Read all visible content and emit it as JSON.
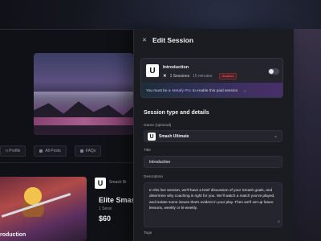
{
  "background": {
    "tabs": [
      {
        "label": "n Profile",
        "icon": "user-icon"
      },
      {
        "label": "All Posts",
        "icon": "grid-icon"
      },
      {
        "label": "FAQs",
        "icon": "help-icon"
      }
    ],
    "game_logo_letter": "U",
    "game_name": "Smash Br",
    "card_title": "Elite Smash",
    "card_meta": "1 Sessi",
    "card_price": "$60",
    "intro_label": "roduction"
  },
  "drawer": {
    "title": "Edit Session",
    "close_icon": "close-icon",
    "service": {
      "logo_letter": "U",
      "name": "Introduction",
      "sessions": "1 Sessions",
      "duration": "15 minutes",
      "status": "Disabled",
      "status_color": "#ff6b6b",
      "toggle_on": false
    },
    "pro_banner": {
      "prefix": "You must be a",
      "link": "Metafy Pro",
      "suffix": "to enable this paid session",
      "arrow": "→"
    },
    "section_title": "Session type and details",
    "game": {
      "label": "Game (optional)",
      "logo_letter": "U",
      "value": "Smash Ultimate"
    },
    "title_field": {
      "label": "Title",
      "value": "Introduction"
    },
    "description": {
      "label": "Description",
      "value": "In this live session, we'll have a brief discussion of your Smash goals, and determine why coaching is right for you. We'll watch a match you've played, and isolate some issues that's evident in your play. Then we'll set up future lessons, weekly or bi-weekly."
    },
    "tags_label": "Tags"
  },
  "colors": {
    "drawer_bg": "#1b1c22",
    "accent_link": "#c7a6ff",
    "badge_bg": "#4a1f25"
  }
}
